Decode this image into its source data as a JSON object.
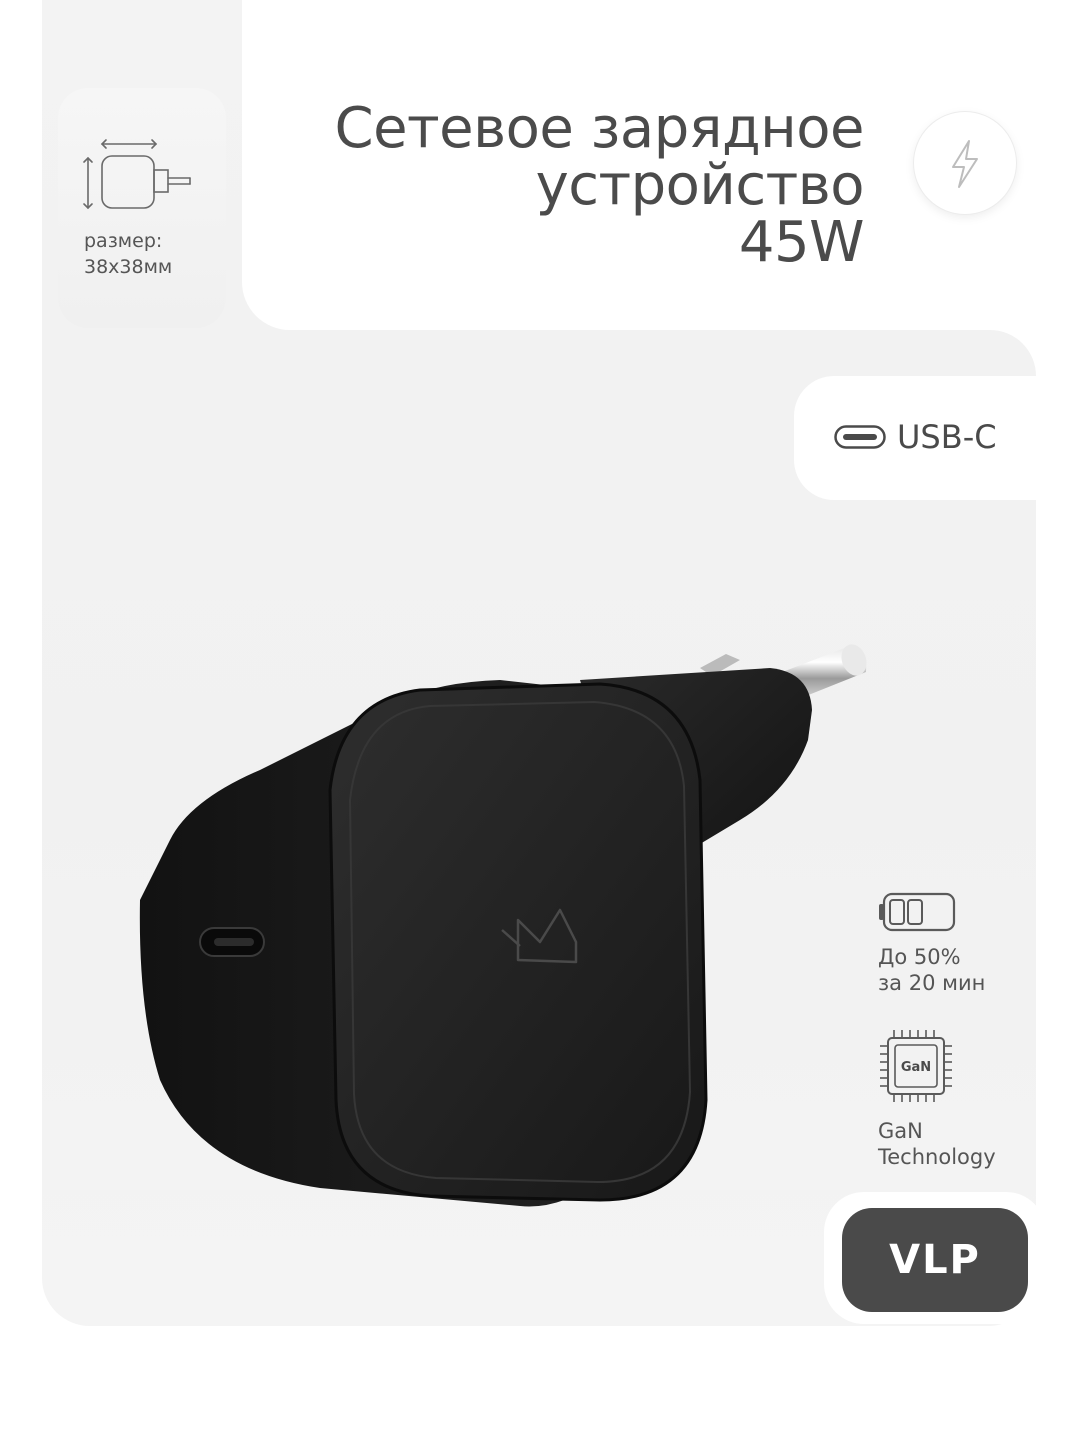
{
  "size_card": {
    "label_line1": "размер:",
    "label_line2": "38х38мм",
    "icon": "charger-dimensions-icon"
  },
  "title": {
    "line1": "Сетевое зарядное",
    "line2": "устройство",
    "line3": "45W"
  },
  "bolt": {
    "icon": "lightning-bolt-icon"
  },
  "connector": {
    "label": "USB-C",
    "icon": "usb-c-port-icon"
  },
  "features": [
    {
      "icon": "battery-icon",
      "line1": "До 50%",
      "line2": "за 20 мин"
    },
    {
      "icon": "gan-chip-icon",
      "chip_text": "GaN",
      "line1": "GaN",
      "line2": "Technology"
    }
  ],
  "brand": {
    "logo_text": "VLP"
  },
  "colors": {
    "panel": "#f2f2f2",
    "product": "#1c1c1c",
    "text": "#4a4a4a",
    "logo_bg": "#4a4a4a"
  }
}
